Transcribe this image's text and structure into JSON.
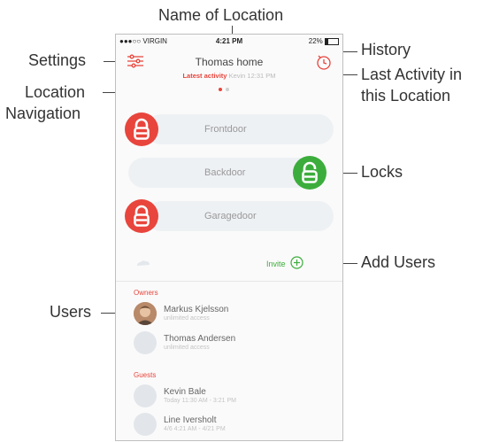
{
  "annotations": {
    "name_of_location": "Name of Location",
    "settings": "Settings",
    "history": "History",
    "last_activity_line1": "Last Activity in",
    "last_activity_line2": "this Location",
    "location_nav_line1": "Location",
    "location_nav_line2": "Navigation",
    "locks": "Locks",
    "add_users": "Add Users",
    "users": "Users"
  },
  "statusbar": {
    "carrier": "●●●○○ VIRGIN",
    "time": "4:21 PM",
    "battery": "22%"
  },
  "header": {
    "title": "Thomas home",
    "latest_activity_label": "Latest activity",
    "latest_activity_value": "Kevin 12:31 PM"
  },
  "locks": [
    {
      "name": "Frontdoor",
      "state": "locked",
      "color": "#e8453c"
    },
    {
      "name": "Backdoor",
      "state": "unlocked",
      "color": "#3cad3c"
    },
    {
      "name": "Garagedoor",
      "state": "locked",
      "color": "#e8453c"
    }
  ],
  "invite": {
    "label": "Invite"
  },
  "owners": {
    "label": "Owners",
    "users": [
      {
        "name": "Markus Kjelsson",
        "sub": "unlimited access"
      },
      {
        "name": "Thomas Andersen",
        "sub": "unlimited access"
      }
    ]
  },
  "guests": {
    "label": "Guests",
    "users": [
      {
        "name": "Kevin Bale",
        "sub": "Today 11:30 AM - 3:21 PM"
      },
      {
        "name": "Line Iversholt",
        "sub": "4/6 4:21 AM - 4/21 PM"
      }
    ]
  },
  "colors": {
    "red": "#e8453c",
    "green": "#3cad3c"
  }
}
